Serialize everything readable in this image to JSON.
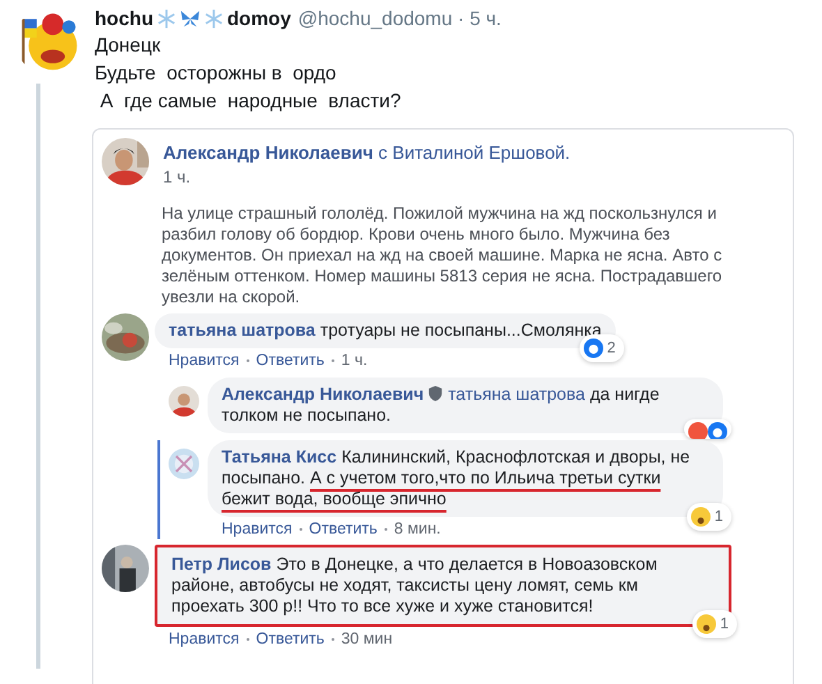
{
  "tweet": {
    "name_start": "hochu",
    "name_end": "domoy",
    "handle": "@hochu_dodomu · 5 ч.",
    "lines": [
      "Донецк",
      "Будьте  осторожны в  ордо",
      " А  где самые  народные  власти?"
    ]
  },
  "post": {
    "author": "Александр Николаевич",
    "with": "с Виталиной Ершовой.",
    "time": "1 ч.",
    "text": "На улице страшный гололёд. Пожилой мужчина на жд поскользнулся и разбил голову об бордюр. Крови очень много было. Мужчина без документов. Он приехал на жд на своей машине. Марка не ясна. Авто с зелёным оттенком. Номер машины 5813 серия не ясна. Пострадавшего увезли на скорой."
  },
  "comments": [
    {
      "author": "татьяна шатрова",
      "text": "тротуары не посыпаны...Смолянка",
      "reactions": [
        {
          "kind": "like"
        }
      ],
      "reaction_count": "2",
      "actions": [
        "Нравится",
        "Ответить",
        "1 ч."
      ],
      "boxed": false,
      "children": [
        {
          "author": "Александр Николаевич",
          "badge": true,
          "tag": "татьяна шатрова",
          "text": "да нигде толком не посыпано.",
          "reactions": [
            {
              "kind": "love"
            },
            {
              "kind": "like"
            }
          ],
          "highlighted": false
        },
        {
          "author": "Татьяна Кисс",
          "badge": false,
          "text": "Калининский, Краснофлотская и дворы, не посыпано. ",
          "underlined": "А с учетом того,что по Ильича третьи сутки бежит вода, вообще эпично",
          "reactions": [
            {
              "kind": "sad"
            }
          ],
          "reaction_count": "1",
          "actions": [
            "Нравится",
            "Ответить",
            "8 мин."
          ],
          "highlighted": true
        }
      ]
    },
    {
      "author": "Петр Лисов",
      "text": "Это в Донецке, а что делается в Новоазовском районе, автобусы не ходят, таксисты цену ломят, семь км проехать 300 р!! Что то все хуже и хуже становится!",
      "reactions": [
        {
          "kind": "sad"
        }
      ],
      "reaction_count": "1",
      "actions": [
        "Нравится",
        "Ответить",
        "30 мин"
      ],
      "boxed": true
    }
  ]
}
